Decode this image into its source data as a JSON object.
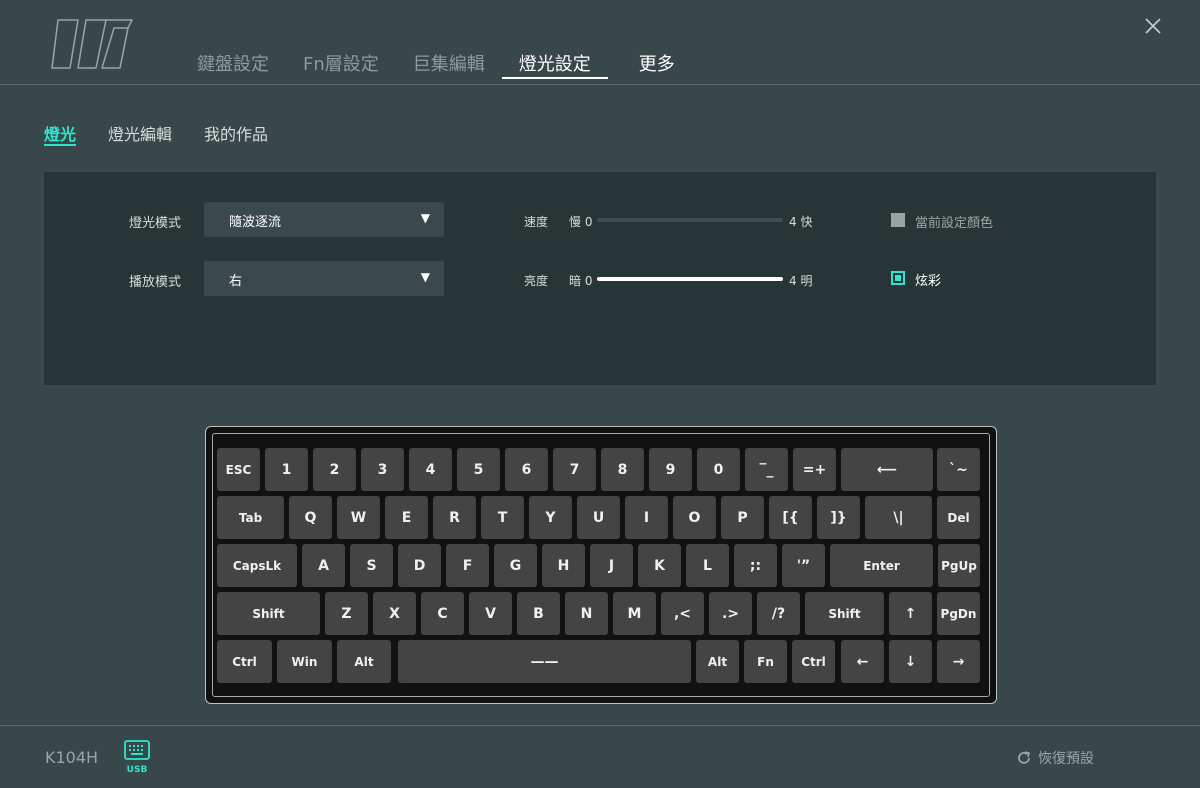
{
  "header": {
    "tabs": [
      "鍵盤設定",
      "Fn層設定",
      "巨集編輯",
      "燈光設定",
      "更多"
    ]
  },
  "sub_tabs": [
    "燈光",
    "燈光編輯",
    "我的作品"
  ],
  "panel": {
    "light_mode_label": "燈光模式",
    "light_mode_value": "隨波逐流",
    "play_mode_label": "播放模式",
    "play_mode_value": "右",
    "speed": {
      "label": "速度",
      "min_label": "慢 0",
      "max_label": "4 快",
      "value": 0,
      "max": 4
    },
    "brightness": {
      "label": "亮度",
      "min_label": "暗 0",
      "max_label": "4 明",
      "value": 4,
      "max": 4
    },
    "options": [
      {
        "label": "當前設定顏色",
        "checked": false
      },
      {
        "label": "炫彩",
        "checked": true
      }
    ]
  },
  "keyboard": {
    "row1": [
      "ESC",
      "1",
      "2",
      "3",
      "4",
      "5",
      "6",
      "7",
      "8",
      "9",
      "0",
      "‾_",
      "=+",
      "⟵",
      "`~"
    ],
    "row2": [
      "Tab",
      "Q",
      "W",
      "E",
      "R",
      "T",
      "Y",
      "U",
      "I",
      "O",
      "P",
      "[{",
      "]}",
      "\\|",
      "Del"
    ],
    "row3": [
      "CapsLk",
      "A",
      "S",
      "D",
      "F",
      "G",
      "H",
      "J",
      "K",
      "L",
      ";:",
      "'”",
      "Enter",
      "PgUp"
    ],
    "row4": [
      "Shift",
      "Z",
      "X",
      "C",
      "V",
      "B",
      "N",
      "M",
      ",<",
      ".>",
      "/?",
      "Shift",
      "↑",
      "PgDn"
    ],
    "row5": [
      "Ctrl",
      "Win",
      "Alt",
      "——",
      "Alt",
      "Fn",
      "Ctrl",
      "←",
      "↓",
      "→"
    ]
  },
  "footer": {
    "model": "K104H",
    "connection": "USB",
    "restore_label": "恢復預設"
  },
  "colors": {
    "accent": "#2ee6d0",
    "background": "#37474a",
    "panel": "#283537",
    "key": "#444444"
  }
}
